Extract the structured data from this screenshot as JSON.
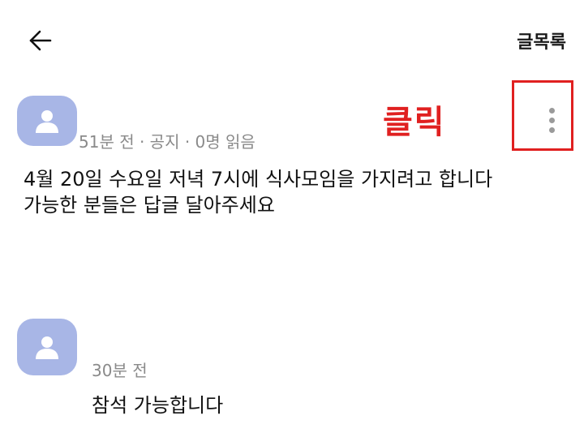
{
  "header": {
    "back_icon": "arrow-left-icon",
    "list_label": "글목록"
  },
  "post": {
    "avatar_icon": "user-silhouette-icon",
    "meta": "51분 전 · 공지 · 0명 읽음",
    "body_lines": [
      "4월 20일 수요일 저녁 7시에 식사모임을 가지려고 합니다",
      "가능한 분들은 답글 달아주세요"
    ],
    "more_icon": "vertical-dots-icon"
  },
  "annotation": {
    "click_label": "클릭",
    "color": "#e02020"
  },
  "comment": {
    "avatar_icon": "user-silhouette-icon",
    "meta": "30분 전",
    "body": "참석 가능합니다"
  },
  "colors": {
    "avatar_bg": "#a8b6e6",
    "meta_text": "#8a8a8a"
  }
}
